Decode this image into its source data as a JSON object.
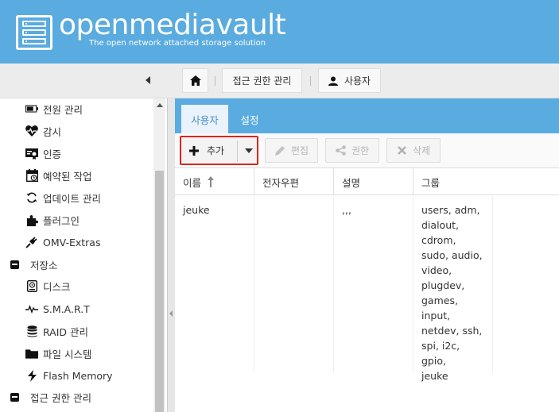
{
  "header": {
    "title": "openmediavault",
    "subtitle": "The open network attached storage solution"
  },
  "breadcrumb": {
    "items": [
      "접근 권한 관리",
      "사용자"
    ]
  },
  "sidebar": {
    "items": [
      {
        "label": "전원 관리",
        "icon": "battery-icon",
        "type": "child"
      },
      {
        "label": "감시",
        "icon": "heartbeat-icon",
        "type": "child"
      },
      {
        "label": "인증",
        "icon": "certificate-icon",
        "type": "child"
      },
      {
        "label": "예약된 작업",
        "icon": "calendar-icon",
        "type": "child"
      },
      {
        "label": "업데이트 관리",
        "icon": "refresh-icon",
        "type": "child"
      },
      {
        "label": "플러그인",
        "icon": "puzzle-icon",
        "type": "child"
      },
      {
        "label": "OMV-Extras",
        "icon": "plug-icon",
        "type": "child"
      },
      {
        "label": "저장소",
        "icon": "collapse-icon",
        "type": "group"
      },
      {
        "label": "디스크",
        "icon": "disk-icon",
        "type": "child"
      },
      {
        "label": "S.M.A.R.T",
        "icon": "pulse-icon",
        "type": "child"
      },
      {
        "label": "RAID 관리",
        "icon": "database-icon",
        "type": "child"
      },
      {
        "label": "파일 시스템",
        "icon": "folder-icon",
        "type": "child"
      },
      {
        "label": "Flash Memory",
        "icon": "bolt-icon",
        "type": "child"
      },
      {
        "label": "접근 권한 관리",
        "icon": "collapse-icon",
        "type": "group"
      }
    ]
  },
  "tabs": [
    {
      "label": "사용자",
      "active": true
    },
    {
      "label": "설정",
      "active": false
    }
  ],
  "toolbar": {
    "add": "추가",
    "edit": "편집",
    "permissions": "권한",
    "delete": "삭제"
  },
  "grid": {
    "columns": [
      "이름",
      "전자우편",
      "설명",
      "그룹"
    ],
    "rows": [
      {
        "name": "jeuke",
        "email": "",
        "description": ",,,",
        "groups": [
          "users, adm,",
          "dialout,",
          "cdrom,",
          "sudo, audio,",
          "video,",
          "plugdev,",
          "games,",
          "input,",
          "netdev, ssh,",
          "spi, i2c, gpio,",
          "jeuke"
        ]
      }
    ]
  },
  "colors": {
    "accent": "#5aabdf",
    "highlight": "#d9261c"
  }
}
